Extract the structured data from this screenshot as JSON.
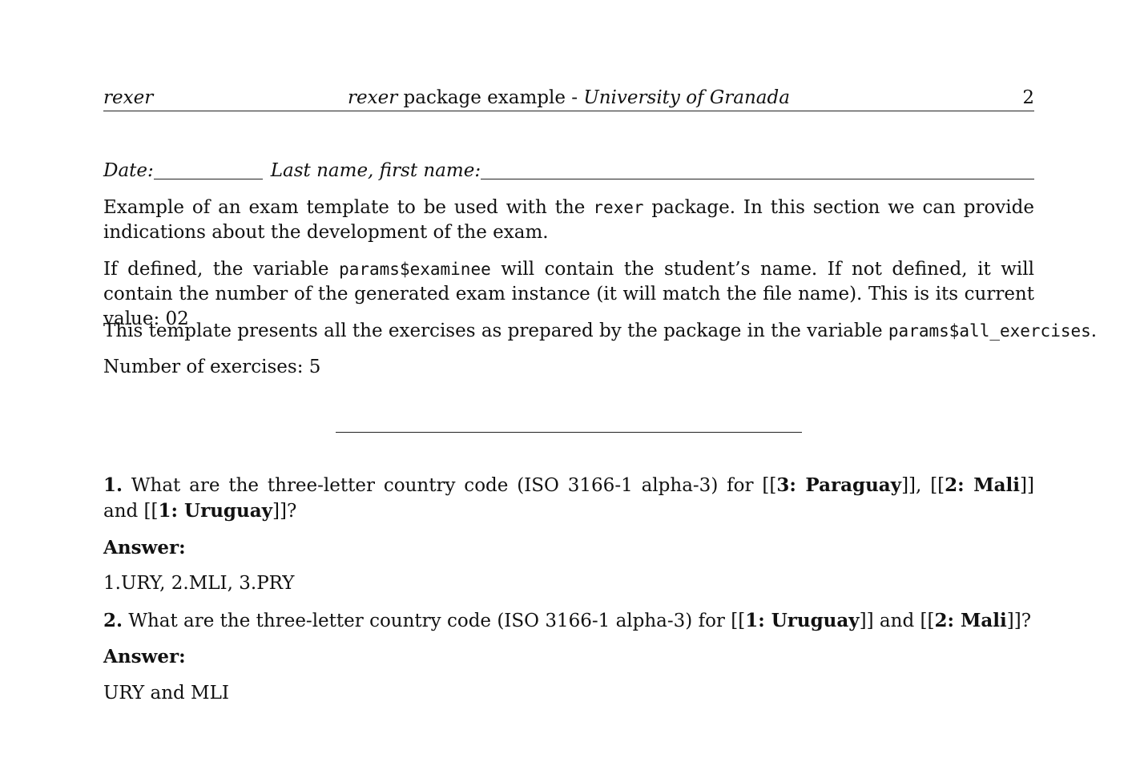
{
  "header": {
    "left": "rexer",
    "center_italic_1": "rexer",
    "center_plain": " package example - ",
    "center_italic_2": "University of Granada",
    "page_number": "2"
  },
  "identification": {
    "date_label": "Date:",
    "name_label": "Last name, first name:"
  },
  "intro": {
    "p1_a": "Example of an exam template to be used with the ",
    "p1_code": "rexer",
    "p1_b": " package. In this section we can provide indications about the development of the exam.",
    "p2_a": "If defined, the variable ",
    "p2_code": "params$examinee",
    "p2_b": " will contain the student’s name. If not defined, it will contain the number of the generated exam instance (it will match the file name). This is its current value: 02",
    "p3_a": "This template presents all the exercises as prepared by the package in the variable ",
    "p3_code": "params$all_exercises",
    "p3_b": ".",
    "p4": "Number of exercises: 5"
  },
  "exercises": [
    {
      "number": "1.",
      "q_a": " What are the three-letter country code (ISO 3166-1 alpha-3) for [[",
      "q_b1": "3: Paraguay",
      "q_c": "]], [[",
      "q_b2": "2: Mali",
      "q_d": "]] and [[",
      "q_b3": "1: Uruguay",
      "q_e": "]]?",
      "answer_label": "Answer:",
      "answer": "1.URY, 2.MLI, 3.PRY"
    },
    {
      "number": "2.",
      "q_a": " What are the three-letter country code (ISO 3166-1 alpha-3) for [[",
      "q_b1": "1: Uruguay",
      "q_c": "]] and [[",
      "q_b2": "2: Mali",
      "q_d": "]]?",
      "answer_label": "Answer:",
      "answer": "URY and MLI"
    }
  ]
}
